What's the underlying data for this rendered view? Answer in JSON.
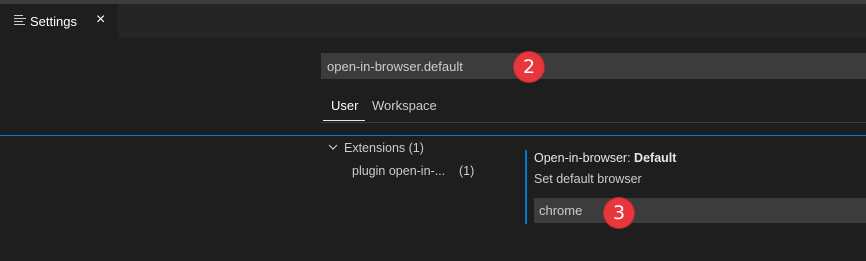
{
  "tab": {
    "icon": "settings-list-icon",
    "label": "Settings",
    "close": "×"
  },
  "search": {
    "value": "open-in-browser.default"
  },
  "annotations": {
    "badge_search": "2",
    "badge_value": "3",
    "badge_color": "#e8373c"
  },
  "scope_tabs": [
    {
      "label": "User",
      "active": true
    },
    {
      "label": "Workspace",
      "active": false
    }
  ],
  "toc": {
    "extensions_label": "Extensions",
    "extensions_count": "(1)",
    "plugin_label": "plugin open-in-...",
    "plugin_count": "(1)"
  },
  "setting": {
    "category": "Open-in-browser: ",
    "name": "Default",
    "description": "Set default browser",
    "value": "chrome"
  },
  "colors": {
    "accent": "#007acc",
    "background": "#1e1e1e"
  }
}
